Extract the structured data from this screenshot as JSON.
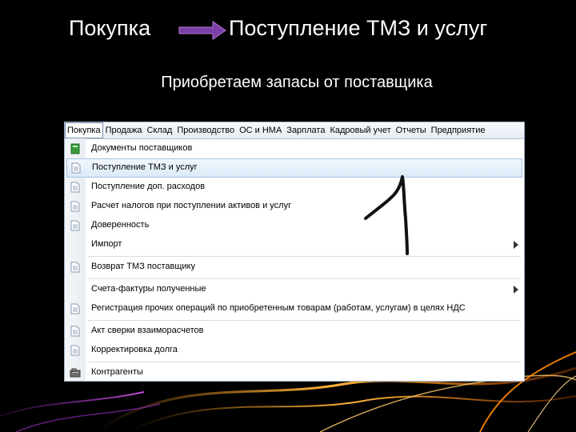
{
  "header": {
    "left": "Покупка",
    "right": "Поступление ТМЗ и услуг",
    "arrow_color": "#7b3fa8"
  },
  "subtitle": "Приобретаем запасы от поставщика",
  "menubar": [
    "Покупка",
    "Продажа",
    "Склад",
    "Производство",
    "ОС и НМА",
    "Зарплата",
    "Кадровый учет",
    "Отчеты",
    "Предприятие"
  ],
  "menu_items": [
    {
      "label": "Документы поставщиков",
      "icon": "book-icon"
    },
    {
      "label": "Поступление ТМЗ и услуг",
      "icon": "document-icon",
      "highlighted": true
    },
    {
      "label": "Поступление доп. расходов",
      "icon": "document-icon"
    },
    {
      "label": "Расчет налогов при поступлении активов и услуг",
      "icon": "document-icon"
    },
    {
      "label": "Доверенность",
      "icon": "document-icon"
    },
    {
      "label": "Импорт",
      "submenu": true
    },
    {
      "label": "Возврат ТМЗ поставщику",
      "icon": "document-icon"
    },
    {
      "label": "Счета-фактуры полученные",
      "submenu": true
    },
    {
      "label": "Регистрация прочих операций по приобретенным товарам (работам, услугам) в целях НДС",
      "icon": "document-icon"
    },
    {
      "label": "Акт сверки взаиморасчетов",
      "icon": "document-icon"
    },
    {
      "label": "Корректировка долга",
      "icon": "document-icon"
    },
    {
      "label": "Контрагенты",
      "icon": "directory-icon"
    }
  ],
  "annotation": "1"
}
